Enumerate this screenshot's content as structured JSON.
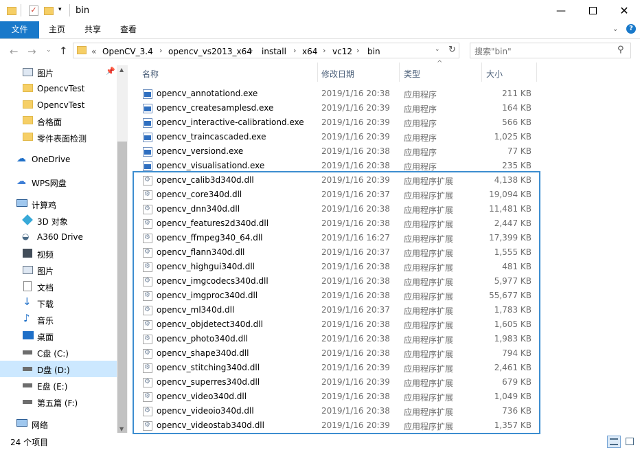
{
  "window": {
    "title": "bin"
  },
  "ribbon": {
    "tabs": [
      "文件",
      "主页",
      "共享",
      "查看"
    ]
  },
  "address": {
    "overflow": "«",
    "crumbs": [
      "OpenCV_3.4",
      "opencv_vs2013_x64",
      "install",
      "x64",
      "vc12",
      "bin"
    ]
  },
  "search": {
    "placeholder": "搜索\"bin\""
  },
  "nav": {
    "quick_access": [
      "图片",
      "OpencvTest",
      "OpencvTest",
      "合格面",
      "零件表面检测"
    ],
    "onedrive": "OneDrive",
    "wps": "WPS网盘",
    "pc": "计算鸡",
    "pc_items": [
      "3D 对象",
      "A360 Drive",
      "视频",
      "图片",
      "文档",
      "下载",
      "音乐",
      "桌面",
      "C盘 (C:)",
      "D盘 (D:)",
      "E盘 (E:)",
      "第五篇 (F:)"
    ],
    "network": "网络"
  },
  "columns": {
    "name": "名称",
    "date": "修改日期",
    "type": "类型",
    "size": "大小"
  },
  "files": [
    {
      "name": "opencv_annotationd.exe",
      "date": "2019/1/16 20:38",
      "type": "应用程序",
      "size": "211 KB",
      "kind": "exe"
    },
    {
      "name": "opencv_createsamplesd.exe",
      "date": "2019/1/16 20:39",
      "type": "应用程序",
      "size": "164 KB",
      "kind": "exe"
    },
    {
      "name": "opencv_interactive-calibrationd.exe",
      "date": "2019/1/16 20:39",
      "type": "应用程序",
      "size": "566 KB",
      "kind": "exe"
    },
    {
      "name": "opencv_traincascaded.exe",
      "date": "2019/1/16 20:39",
      "type": "应用程序",
      "size": "1,025 KB",
      "kind": "exe"
    },
    {
      "name": "opencv_versiond.exe",
      "date": "2019/1/16 20:38",
      "type": "应用程序",
      "size": "77 KB",
      "kind": "exe"
    },
    {
      "name": "opencv_visualisationd.exe",
      "date": "2019/1/16 20:38",
      "type": "应用程序",
      "size": "235 KB",
      "kind": "exe"
    },
    {
      "name": "opencv_calib3d340d.dll",
      "date": "2019/1/16 20:39",
      "type": "应用程序扩展",
      "size": "4,138 KB",
      "kind": "dll"
    },
    {
      "name": "opencv_core340d.dll",
      "date": "2019/1/16 20:37",
      "type": "应用程序扩展",
      "size": "19,094 KB",
      "kind": "dll"
    },
    {
      "name": "opencv_dnn340d.dll",
      "date": "2019/1/16 20:38",
      "type": "应用程序扩展",
      "size": "11,481 KB",
      "kind": "dll"
    },
    {
      "name": "opencv_features2d340d.dll",
      "date": "2019/1/16 20:38",
      "type": "应用程序扩展",
      "size": "2,447 KB",
      "kind": "dll"
    },
    {
      "name": "opencv_ffmpeg340_64.dll",
      "date": "2019/1/16 16:27",
      "type": "应用程序扩展",
      "size": "17,399 KB",
      "kind": "dll"
    },
    {
      "name": "opencv_flann340d.dll",
      "date": "2019/1/16 20:37",
      "type": "应用程序扩展",
      "size": "1,555 KB",
      "kind": "dll"
    },
    {
      "name": "opencv_highgui340d.dll",
      "date": "2019/1/16 20:38",
      "type": "应用程序扩展",
      "size": "481 KB",
      "kind": "dll"
    },
    {
      "name": "opencv_imgcodecs340d.dll",
      "date": "2019/1/16 20:38",
      "type": "应用程序扩展",
      "size": "5,977 KB",
      "kind": "dll"
    },
    {
      "name": "opencv_imgproc340d.dll",
      "date": "2019/1/16 20:38",
      "type": "应用程序扩展",
      "size": "55,677 KB",
      "kind": "dll"
    },
    {
      "name": "opencv_ml340d.dll",
      "date": "2019/1/16 20:37",
      "type": "应用程序扩展",
      "size": "1,783 KB",
      "kind": "dll"
    },
    {
      "name": "opencv_objdetect340d.dll",
      "date": "2019/1/16 20:38",
      "type": "应用程序扩展",
      "size": "1,605 KB",
      "kind": "dll"
    },
    {
      "name": "opencv_photo340d.dll",
      "date": "2019/1/16 20:38",
      "type": "应用程序扩展",
      "size": "1,983 KB",
      "kind": "dll"
    },
    {
      "name": "opencv_shape340d.dll",
      "date": "2019/1/16 20:38",
      "type": "应用程序扩展",
      "size": "794 KB",
      "kind": "dll"
    },
    {
      "name": "opencv_stitching340d.dll",
      "date": "2019/1/16 20:39",
      "type": "应用程序扩展",
      "size": "2,461 KB",
      "kind": "dll"
    },
    {
      "name": "opencv_superres340d.dll",
      "date": "2019/1/16 20:39",
      "type": "应用程序扩展",
      "size": "679 KB",
      "kind": "dll"
    },
    {
      "name": "opencv_video340d.dll",
      "date": "2019/1/16 20:38",
      "type": "应用程序扩展",
      "size": "1,049 KB",
      "kind": "dll"
    },
    {
      "name": "opencv_videoio340d.dll",
      "date": "2019/1/16 20:38",
      "type": "应用程序扩展",
      "size": "736 KB",
      "kind": "dll"
    },
    {
      "name": "opencv_videostab340d.dll",
      "date": "2019/1/16 20:39",
      "type": "应用程序扩展",
      "size": "1,357 KB",
      "kind": "dll"
    }
  ],
  "status": {
    "count": "24 个项目"
  },
  "colors": {
    "accent": "#1979ca",
    "highlight": "#3c8dd0",
    "selected_drive": "#cce8ff"
  }
}
